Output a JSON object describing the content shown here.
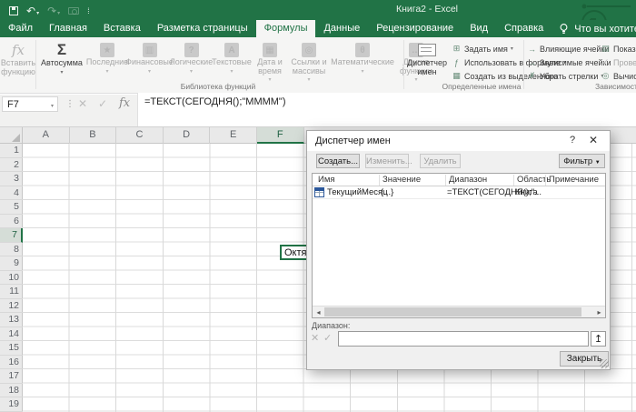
{
  "window": {
    "title": "Книга2 - Excel"
  },
  "qat": {
    "icons": [
      "save-icon",
      "undo-icon",
      "redo-icon",
      "camera-icon",
      "customize-qat-icon"
    ]
  },
  "tabs": [
    {
      "label": "Файл"
    },
    {
      "label": "Главная"
    },
    {
      "label": "Вставка"
    },
    {
      "label": "Разметка страницы"
    },
    {
      "label": "Формулы",
      "active": true
    },
    {
      "label": "Данные"
    },
    {
      "label": "Рецензирование"
    },
    {
      "label": "Вид"
    },
    {
      "label": "Справка"
    }
  ],
  "tell_me": {
    "label": "Что вы хотите сделать?"
  },
  "ribbon": {
    "insert_function": {
      "label": "Вставить функцию",
      "disabled": true
    },
    "function_library": {
      "group_label": "Библиотека функций",
      "buttons": [
        {
          "label": "Автосумма",
          "icon": "autosum-sigma-icon",
          "glyph": "Σ",
          "disabled": false,
          "boxed": false
        },
        {
          "label": "Последние",
          "icon": "recent-functions-icon",
          "glyph": "★",
          "disabled": true,
          "boxed": true
        },
        {
          "label": "Финансовые",
          "icon": "financial-icon",
          "glyph": "▥",
          "disabled": true,
          "boxed": true
        },
        {
          "label": "Логические",
          "icon": "logical-icon",
          "glyph": "?",
          "disabled": true,
          "boxed": true
        },
        {
          "label": "Текстовые",
          "icon": "text-functions-icon",
          "glyph": "А",
          "disabled": true,
          "boxed": true
        },
        {
          "label": "Дата и время",
          "icon": "date-time-icon",
          "glyph": "▦",
          "disabled": true,
          "boxed": true
        },
        {
          "label": "Ссылки и массивы",
          "icon": "lookup-reference-icon",
          "glyph": "◎",
          "disabled": true,
          "boxed": true
        },
        {
          "label": "Математические",
          "icon": "math-trig-icon",
          "glyph": "θ",
          "disabled": true,
          "boxed": true
        },
        {
          "label": "Другие функции",
          "icon": "more-functions-icon",
          "glyph": "…",
          "disabled": true,
          "boxed": true
        }
      ]
    },
    "defined_names": {
      "group_label": "Определенные имена",
      "name_manager": {
        "label": "Диспетчер имен"
      },
      "items": [
        {
          "label": "Задать имя",
          "icon": "define-name-icon",
          "glyph": "⊞",
          "caret": true
        },
        {
          "label": "Использовать в формуле",
          "icon": "use-in-formula-icon",
          "glyph": "ƒ",
          "caret": true
        },
        {
          "label": "Создать из выделенного",
          "icon": "create-from-selection-icon",
          "glyph": "▦",
          "caret": false
        }
      ]
    },
    "formula_auditing": {
      "group_label": "Зависимости формул",
      "left_items": [
        {
          "label": "Влияющие ячейки",
          "icon": "trace-precedents-icon",
          "glyph": "→"
        },
        {
          "label": "Зависимые ячейки",
          "icon": "trace-dependents-icon",
          "glyph": "→"
        },
        {
          "label": "Убрать стрелки",
          "icon": "remove-arrows-icon",
          "glyph": "✗",
          "caret": true
        }
      ],
      "right_items": [
        {
          "label": "Показать формулы",
          "icon": "show-formulas-icon",
          "glyph": "▤"
        },
        {
          "label": "Проверка наличия ошибок",
          "icon": "error-checking-icon",
          "glyph": "✓",
          "disabled": true
        },
        {
          "label": "Вычислить формулу",
          "icon": "evaluate-formula-icon",
          "glyph": "◎"
        }
      ]
    }
  },
  "formula_bar": {
    "name_box": "F7",
    "formula": "=ТЕКСТ(СЕГОДНЯ();\"ММММ\")"
  },
  "sheet": {
    "columns": [
      "A",
      "B",
      "C",
      "D",
      "E",
      "F"
    ],
    "rows": [
      "1",
      "2",
      "3",
      "4",
      "5",
      "6",
      "7",
      "8",
      "9",
      "10",
      "11",
      "12",
      "13",
      "14",
      "15",
      "16",
      "17",
      "18",
      "19"
    ],
    "active_cell": {
      "ref": "F7",
      "value": "Октябрь"
    },
    "selected_column": "F",
    "selected_row": "7"
  },
  "name_manager": {
    "title": "Диспетчер имен",
    "buttons": {
      "create": "Создать...",
      "edit": "Изменить...",
      "delete": "Удалить",
      "filter": "Фильтр",
      "close": "Закрыть"
    },
    "help_glyph": "?",
    "close_glyph": "✕",
    "table": {
      "headers": [
        "Имя",
        "Значение",
        "Диапазон",
        "Область",
        "Примечание"
      ],
      "rows": [
        {
          "name": "ТекущийМесяц",
          "value": "{...}",
          "range": "=ТЕКСТ(СЕГОДНЯ();\"...",
          "scope": "Книга",
          "comment": ""
        }
      ]
    },
    "range_label": "Диапазон:"
  },
  "colors": {
    "excel_green": "#217346",
    "selection_green": "#217346"
  }
}
